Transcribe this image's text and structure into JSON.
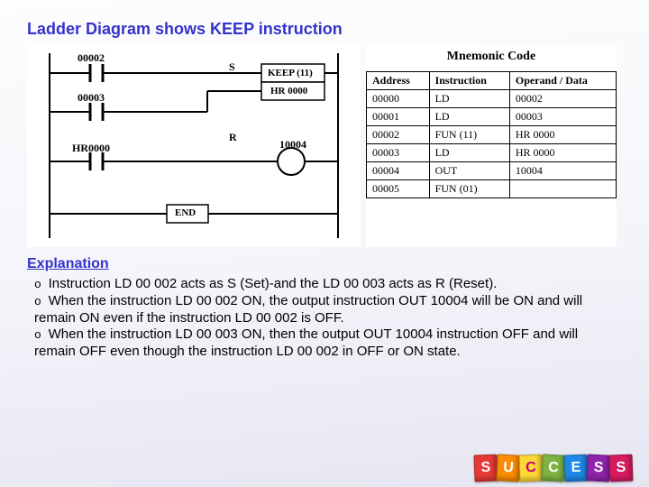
{
  "title": "Ladder Diagram shows KEEP instruction",
  "ladder": {
    "c00002": "00002",
    "c00003": "00003",
    "hr0000": "HR0000",
    "s": "S",
    "r": "R",
    "keep": "KEEP (11)",
    "hrbox": "HR 0000",
    "coil": "10004",
    "end": "END"
  },
  "mnemonic": {
    "title": "Mnemonic Code",
    "headers": {
      "addr": "Address",
      "instr": "Instruction",
      "op": "Operand / Data"
    },
    "rows": [
      {
        "addr": "00000",
        "instr": "LD",
        "op": "00002"
      },
      {
        "addr": "00001",
        "instr": "LD",
        "op": "00003"
      },
      {
        "addr": "00002",
        "instr": "FUN (11)",
        "op": "HR 0000"
      },
      {
        "addr": "00003",
        "instr": "LD",
        "op": "HR 0000"
      },
      {
        "addr": "00004",
        "instr": "OUT",
        "op": "10004"
      },
      {
        "addr": "00005",
        "instr": "FUN (01)",
        "op": ""
      }
    ]
  },
  "explanation": {
    "heading": "Explanation",
    "b1": "Instruction LD 00 002 acts as S (Set)-and the LD 00 003 acts as R (Reset).",
    "b2": "When the instruction LD 00 002 ON, the output instruction OUT 10004 will be ON and will remain ON even if the instruction LD 00 002 is OFF.",
    "b3": "When the instruction LD 00 003 ON, then the output OUT 10004 instruction OFF and will remain OFF even though the instruction LD 00 002 in OFF or ON state."
  },
  "blocks": {
    "l0": "S",
    "l1": "U",
    "l2": "C",
    "l3": "C",
    "l4": "E",
    "l5": "S",
    "l6": "S"
  }
}
